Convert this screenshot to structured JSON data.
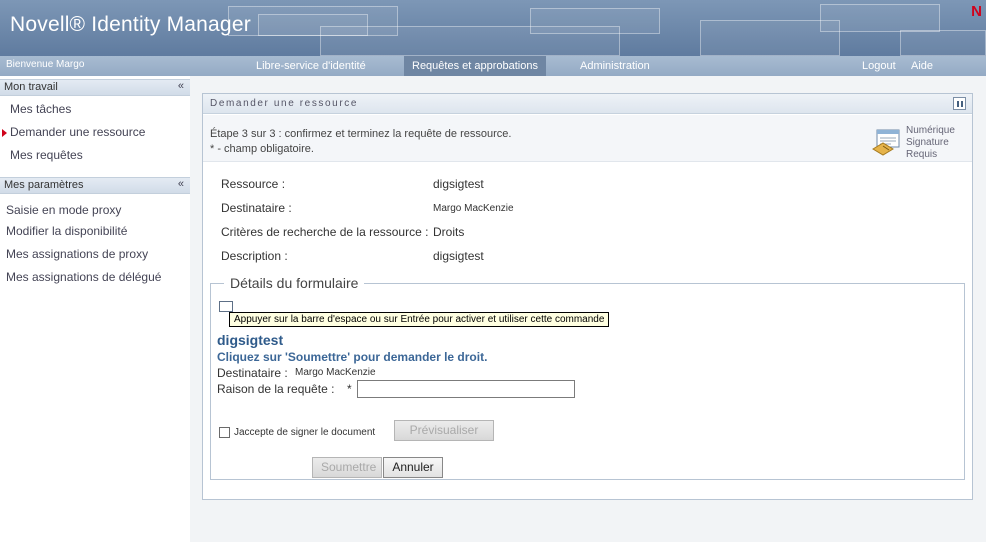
{
  "app": {
    "title": "Novell® Identity Manager",
    "brand_mark": "N",
    "welcome": "Bienvenue Margo"
  },
  "nav": {
    "tabs": [
      "Libre-service d'identité",
      "Requêtes et approbations",
      "Administration"
    ],
    "active_tab": "Requêtes et approbations",
    "logout": "Logout",
    "help": "Aide"
  },
  "sidebar": {
    "sections": [
      {
        "title": "Mon travail",
        "items": [
          "Mes tâches",
          "Demander une ressource",
          "Mes requêtes"
        ],
        "selected": "Demander une ressource"
      },
      {
        "title": "Mes paramètres",
        "items": [
          "Saisie en mode proxy",
          "Modifier la disponibilité",
          "Mes assignations de proxy",
          "Mes assignations de délégué"
        ]
      }
    ],
    "collapse_icon": "double-chevron-up-icon"
  },
  "panel": {
    "title": "Demander une ressource",
    "step": "Étape 3 sur 3 : confirmez et terminez la requête de ressource.",
    "required_note": "* - champ obligatoire.",
    "signature": [
      "Numérique",
      "Signature",
      "Requis"
    ],
    "signature_icon": "digital-signature-icon",
    "info": [
      {
        "label": "Ressource :",
        "value": "digsigtest"
      },
      {
        "label": "Destinataire :",
        "value": "Margo MacKenzie"
      },
      {
        "label": "Critères de recherche de la ressource :",
        "value": "Droits"
      },
      {
        "label": "Description :",
        "value": "digsigtest"
      }
    ]
  },
  "form": {
    "legend": "Détails du formulaire",
    "tooltip": "Appuyer sur la barre d'espace ou sur Entrée pour activer et utiliser cette commande",
    "title": "digsigtest",
    "subtitle": "Cliquez sur 'Soumettre' pour demander le droit.",
    "recipient_label": "Destinataire :",
    "recipient_value": "Margo MacKenzie",
    "reason_label": "Raison de la requête :",
    "required_mark": "*",
    "reason_value": "",
    "sign_label": "Jaccepte de signer le document",
    "sign_checked": false,
    "preview_button": "Prévisualiser",
    "submit_button": "Soumettre",
    "cancel_button": "Annuler"
  },
  "colors": {
    "banner": "#6a86a9",
    "navbar": "#9eb3cb",
    "active_tab": "#6f86a3",
    "accent_red": "#d0021b",
    "form_title": "#2e5a8a"
  }
}
